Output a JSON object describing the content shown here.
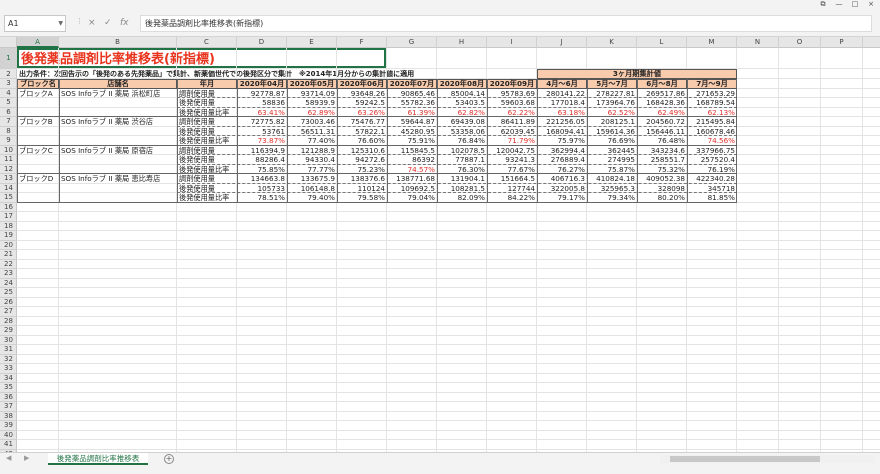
{
  "formula_bar": {
    "name_box": "A1",
    "cancel_icon": "×",
    "enter_icon": "✓",
    "function_icon": "fx",
    "formula": "後発薬品調剤比率推移表(新指標)"
  },
  "columns": [
    "A",
    "B",
    "C",
    "D",
    "E",
    "F",
    "G",
    "H",
    "I",
    "J",
    "K",
    "L",
    "M",
    "N",
    "O",
    "P",
    "Q"
  ],
  "rows": [
    "1",
    "2",
    "3",
    "4",
    "5",
    "6",
    "7",
    "8",
    "9",
    "10",
    "11",
    "12",
    "13",
    "14",
    "15",
    "16",
    "17",
    "18",
    "19",
    "20",
    "21",
    "22",
    "23",
    "24",
    "25",
    "26",
    "27",
    "28",
    "29",
    "30",
    "31",
    "32",
    "33",
    "34",
    "35",
    "36",
    "37",
    "38",
    "39",
    "40",
    "41",
    "42"
  ],
  "sheet": {
    "title": "後発薬品調剤比率推移表(新指標)",
    "condition": "出力条件：次回告示の「後発のある先発薬品」で集計、新薬価世代での後発区分で集計　※2014年1月分からの集計値に適用",
    "three_month_label": "3ヶ月期集計値",
    "headers": {
      "block": "ブロック名",
      "store": "店舗名",
      "year_month": "年月",
      "months": [
        "2020年04月",
        "2020年05月",
        "2020年06月",
        "2020年07月",
        "2020年08月",
        "2020年09月"
      ],
      "periods": [
        "4月～6月",
        "5月～7月",
        "6月～8月",
        "7月～9月"
      ]
    },
    "blocks": [
      {
        "block": "ブロックA",
        "store": "SOS Infoラブ II 薬局 浜松町店",
        "rows": [
          {
            "label": "調剤使用量",
            "values": [
              "92778.87",
              "93714.09",
              "93648.26",
              "90865.46",
              "85004.14",
              "95783.69"
            ],
            "periods": [
              "280141.22",
              "278227.81",
              "269517.86",
              "271653.29"
            ]
          },
          {
            "label": "後発使用量",
            "values": [
              "58836",
              "58939.9",
              "59242.5",
              "55782.36",
              "53403.5",
              "59603.68"
            ],
            "periods": [
              "177018.4",
              "173964.76",
              "168428.36",
              "168789.54"
            ]
          },
          {
            "label": "後発使用量比率",
            "values": [
              "63.41%",
              "62.89%",
              "63.26%",
              "61.39%",
              "62.82%",
              "62.22%"
            ],
            "periods": [
              "63.18%",
              "62.52%",
              "62.49%",
              "62.13%"
            ],
            "red": true
          }
        ]
      },
      {
        "block": "ブロックB",
        "store": "SOS Infoラブ II 薬局 渋谷店",
        "rows": [
          {
            "label": "調剤使用量",
            "values": [
              "72775.82",
              "73003.46",
              "75476.77",
              "59644.87",
              "69439.08",
              "86411.89"
            ],
            "periods": [
              "221256.05",
              "208125.1",
              "204560.72",
              "215495.84"
            ]
          },
          {
            "label": "後発使用量",
            "values": [
              "53761",
              "56511.31",
              "57822.1",
              "45280.95",
              "53358.06",
              "62039.45"
            ],
            "periods": [
              "168094.41",
              "159614.36",
              "156446.11",
              "160678.46"
            ]
          },
          {
            "label": "後発使用量比率",
            "values": [
              "73.87%",
              "77.40%",
              "76.60%",
              "75.91%",
              "76.84%",
              "71.79%"
            ],
            "periods": [
              "75.97%",
              "76.69%",
              "76.48%",
              "74.56%"
            ],
            "red_values": [
              true,
              false,
              false,
              false,
              false,
              true
            ],
            "red_periods": [
              false,
              false,
              false,
              true
            ]
          }
        ]
      },
      {
        "block": "ブロックC",
        "store": "SOS Infoラブ II 薬局 原宿店",
        "rows": [
          {
            "label": "調剤使用量",
            "values": [
              "116394.9",
              "121288.9",
              "125310.6",
              "115845.5",
              "102078.5",
              "120042.75"
            ],
            "periods": [
              "362994.4",
              "362445",
              "343234.6",
              "337966.75"
            ]
          },
          {
            "label": "後発使用量",
            "values": [
              "88286.4",
              "94330.4",
              "94272.6",
              "86392",
              "77887.1",
              "93241.3"
            ],
            "periods": [
              "276889.4",
              "274995",
              "258551.7",
              "257520.4"
            ]
          },
          {
            "label": "後発使用量比率",
            "values": [
              "75.85%",
              "77.77%",
              "75.23%",
              "74.57%",
              "76.30%",
              "77.67%"
            ],
            "periods": [
              "76.27%",
              "75.87%",
              "75.32%",
              "76.19%"
            ],
            "red_values": [
              false,
              false,
              false,
              true,
              false,
              false
            ],
            "red_periods": [
              false,
              false,
              false,
              false
            ]
          }
        ]
      },
      {
        "block": "ブロックD",
        "store": "SOS Infoラブ II 薬局 恵比寿店",
        "rows": [
          {
            "label": "調剤使用量",
            "values": [
              "134663.8",
              "133675.9",
              "138376.6",
              "138771.68",
              "131904.1",
              "151664.5"
            ],
            "periods": [
              "406716.3",
              "410824.18",
              "409052.38",
              "422340.28"
            ]
          },
          {
            "label": "後発使用量",
            "values": [
              "105733",
              "106148.8",
              "110124",
              "109692.5",
              "108281.5",
              "127744"
            ],
            "periods": [
              "322005.8",
              "325965.3",
              "328098",
              "345718"
            ]
          },
          {
            "label": "後発使用量比率",
            "values": [
              "78.51%",
              "79.40%",
              "79.58%",
              "79.04%",
              "82.09%",
              "84.22%"
            ],
            "periods": [
              "79.17%",
              "79.34%",
              "80.20%",
              "81.85%"
            ]
          }
        ]
      }
    ]
  },
  "tabs": {
    "sheet_name": "後発薬品調剤比率推移表",
    "add_sheet": "+"
  },
  "window": {
    "restore": "⧉",
    "minimize": "—",
    "maximize": "□",
    "close": "×"
  }
}
